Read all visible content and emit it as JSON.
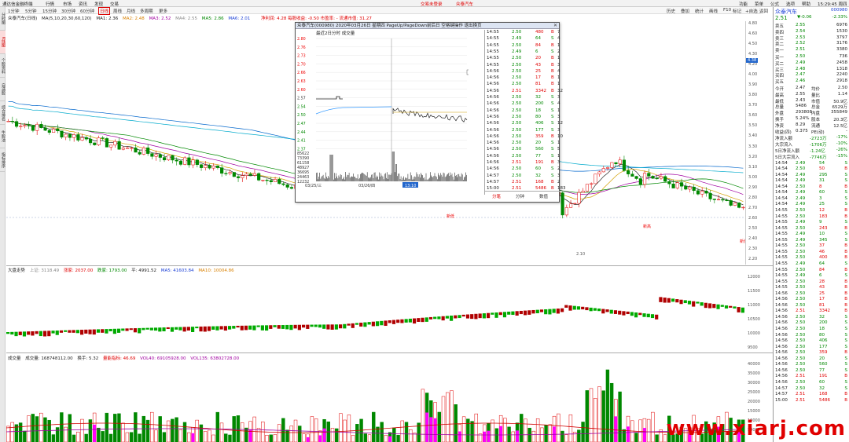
{
  "titlebar": {
    "app": "通达信金融终端",
    "menus": [
      "行情",
      "市场",
      "资讯",
      "发现",
      "交易"
    ],
    "center_text": "交易未登录",
    "stock_name": "众泰汽车",
    "right_items": [
      "功能",
      "菜单",
      "公式",
      "选项",
      "帮助"
    ],
    "time": "15:29:45 周四"
  },
  "sidebar": {
    "tabs": [
      "分时图",
      "K线图",
      "个股资料",
      "自选股",
      "综合排名",
      "牛股池",
      "指标排序"
    ]
  },
  "periodbar": {
    "items": [
      "1分钟",
      "5分钟",
      "15分钟",
      "30分钟",
      "60分钟",
      "日线",
      "周线",
      "月线",
      "多周期",
      "更多"
    ],
    "active_index": 5
  },
  "right_toolbar": [
    "历史",
    "叠加",
    "统计",
    "画线",
    "F10",
    "标记",
    "+自选",
    "返回"
  ],
  "main_legend": {
    "title": "众泰汽车(日线)",
    "ma_spec": "MA(5,10,20,30,60,120)",
    "ma1": "MA1: 2.36",
    "ma2": "MA2: 2.48",
    "ma3": "MA3: 2.52",
    "ma4": "MA4: 2.55",
    "ma5": "MA5: 2.86",
    "ma6": "MA6: 2.01",
    "indicator": "净利润: 4.28  每股收益: -0.50  市盈率: -  流通市值: 31.27"
  },
  "main_axis": [
    "2.10"
  ],
  "main_annotations": [
    "新低",
    "新高",
    "新低"
  ],
  "dapan_legend": {
    "title": "大盘走势",
    "items": [
      "上证: 3118.49",
      "涨家: 2037.00",
      "跌家: 1793.00",
      "平: 4991.52",
      "MA5: 41603.84",
      "MA10: 10004.86"
    ]
  },
  "dapan_axis": [
    "12000",
    "11500",
    "11000",
    "10500",
    "10000",
    "9500"
  ],
  "vol_legend": {
    "title": "成交量",
    "items": [
      "成交量: 168748112.00",
      "换手: 5.32",
      "量能指标: 46.69",
      "VOL40: 69105928.00",
      "VOL135: 63802728.00"
    ]
  },
  "vol_axis": [
    "40000",
    "35000",
    "30000",
    "25000",
    "20000",
    "15000",
    "10000",
    "5000"
  ],
  "popup": {
    "title": "众泰汽车(000980) 2020年03月26日 星期四 PageUp/PageDown前后日 空格键操作 退出换页",
    "sub": "最近2日分时  成交量",
    "price_axis_left": [
      "2.80",
      "2.76",
      "2.73",
      "2.70",
      "2.66",
      "2.63",
      "2.60",
      "2.57",
      "2.54",
      "2.50",
      "2.47",
      "2.44",
      "2.41",
      "2.37"
    ],
    "pct_axis_right": [
      "9.00%",
      "7.67%",
      "6.32%",
      "5.00%",
      "3.64%",
      "2.56%",
      "1.28%",
      "0.00%",
      "1.28%",
      "2.56%",
      "3.84%",
      "5.11%",
      "6.39%",
      "7.67%"
    ],
    "vol_axis": [
      "85622",
      "73390",
      "61158",
      "48927",
      "36695",
      "24463",
      "12232"
    ],
    "dates": [
      "03/25/三",
      "03/26/四"
    ],
    "marker": "13:10",
    "ticks": [
      {
        "t": "14:55",
        "p": "2.50",
        "v": "480",
        "s": "B",
        "n": "7"
      },
      {
        "t": "14:55",
        "p": "2.49",
        "v": "64",
        "s": "S",
        "n": "4"
      },
      {
        "t": "14:55",
        "p": "2.50",
        "v": "84",
        "s": "B",
        "n": "1"
      },
      {
        "t": "14:55",
        "p": "2.49",
        "v": "6",
        "s": "S",
        "n": "2"
      },
      {
        "t": "14:55",
        "p": "2.50",
        "v": "20",
        "s": "B",
        "n": "1"
      },
      {
        "t": "14:55",
        "p": "2.50",
        "v": "43",
        "s": "B",
        "n": "3"
      },
      {
        "t": "14:56",
        "p": "2.50",
        "v": "25",
        "s": "B",
        "n": "4"
      },
      {
        "t": "14:56",
        "p": "2.50",
        "v": "17",
        "s": "B",
        "n": "1"
      },
      {
        "t": "14:56",
        "p": "2.50",
        "v": "81",
        "s": "B",
        "n": "1"
      },
      {
        "t": "14:56",
        "p": "2.51",
        "v": "3342",
        "s": "B",
        "n": "32"
      },
      {
        "t": "14:56",
        "p": "2.50",
        "v": "32",
        "s": "S",
        "n": "3"
      },
      {
        "t": "14:56",
        "p": "2.50",
        "v": "200",
        "s": "S",
        "n": "4"
      },
      {
        "t": "14:56",
        "p": "2.50",
        "v": "18",
        "s": "S",
        "n": "1"
      },
      {
        "t": "14:56",
        "p": "2.50",
        "v": "80",
        "s": "S",
        "n": "3"
      },
      {
        "t": "14:56",
        "p": "2.50",
        "v": "406",
        "s": "S",
        "n": "12"
      },
      {
        "t": "14:56",
        "p": "2.50",
        "v": "177",
        "s": "S",
        "n": "3"
      },
      {
        "t": "14:56",
        "p": "2.50",
        "v": "359",
        "s": "B",
        "n": "10"
      },
      {
        "t": "14:56",
        "p": "2.50",
        "v": "20",
        "s": "S",
        "n": "1"
      },
      {
        "t": "14:56",
        "p": "2.50",
        "v": "560",
        "s": "S",
        "n": "5"
      },
      {
        "t": "14:56",
        "p": "2.50",
        "v": "77",
        "s": "S",
        "n": "1"
      },
      {
        "t": "14:56",
        "p": "2.51",
        "v": "191",
        "s": "B",
        "n": "3"
      },
      {
        "t": "14:56",
        "p": "2.50",
        "v": "60",
        "s": "S",
        "n": "2"
      },
      {
        "t": "14:57",
        "p": "2.50",
        "v": "32",
        "s": "S",
        "n": "3"
      },
      {
        "t": "14:57",
        "p": "2.51",
        "v": "168",
        "s": "B",
        "n": "2"
      },
      {
        "t": "15:00",
        "p": "2.51",
        "v": "5486",
        "s": "B",
        "n": "183"
      }
    ],
    "tabs": [
      "分笔",
      "分钟",
      "数值"
    ]
  },
  "rpanel": {
    "name": "众泰汽车",
    "code": "000980",
    "price": "2.51",
    "change": "▼-0.06",
    "pct": "-2.33%",
    "sells": [
      {
        "label": "卖五",
        "price": "2.55",
        "vol": "6976"
      },
      {
        "label": "卖四",
        "price": "2.54",
        "vol": "1530"
      },
      {
        "label": "卖三",
        "price": "2.53",
        "vol": "3797"
      },
      {
        "label": "卖二",
        "price": "2.52",
        "vol": "3176"
      },
      {
        "label": "卖一",
        "price": "2.51",
        "vol": "3380"
      }
    ],
    "buys": [
      {
        "label": "买一",
        "price": "2.50",
        "vol": "736"
      },
      {
        "label": "买二",
        "price": "2.49",
        "vol": "2458"
      },
      {
        "label": "买三",
        "price": "2.48",
        "vol": "1318"
      },
      {
        "label": "买四",
        "price": "2.47",
        "vol": "2240"
      },
      {
        "label": "买五",
        "price": "2.46",
        "vol": "2918"
      }
    ],
    "stats": [
      {
        "a": "今开",
        "b": "2.47",
        "c": "均价",
        "d": "2.50"
      },
      {
        "a": "最高",
        "b": "2.55",
        "c": "量比",
        "d": "1.14"
      },
      {
        "a": "最低",
        "b": "2.43",
        "c": "市值",
        "d": "50.9亿"
      },
      {
        "a": "总量",
        "b": "5486",
        "c": "总金",
        "d": "6529万"
      },
      {
        "a": "外盘",
        "b": "293808",
        "c": "内盘",
        "d": "355849"
      },
      {
        "a": "换手",
        "b": "5.24%",
        "c": "股本",
        "d": "20.3亿"
      },
      {
        "a": "净资",
        "b": "8.29",
        "c": "流通",
        "d": "12.5亿"
      },
      {
        "a": "收益(四)",
        "b": "0.375",
        "c": "PE(动)",
        "d": "-"
      }
    ],
    "flows": [
      {
        "a": "净流入额",
        "b": "-2723万",
        "c": "-17%"
      },
      {
        "a": "大宗流入",
        "b": "-1706万",
        "c": "-10%"
      },
      {
        "a": "5日净流入额",
        "b": "-1.24亿",
        "c": "-26%"
      },
      {
        "a": "5日大宗流入",
        "b": "-7746万",
        "c": "-15%"
      }
    ],
    "ticks": [
      {
        "t": "14:54",
        "p": "2.49",
        "v": "54",
        "s": "S"
      },
      {
        "t": "14:54",
        "p": "2.50",
        "v": "50",
        "s": "B"
      },
      {
        "t": "14:54",
        "p": "2.49",
        "v": "295",
        "s": "S"
      },
      {
        "t": "14:54",
        "p": "2.49",
        "v": "31",
        "s": "S"
      },
      {
        "t": "14:54",
        "p": "2.50",
        "v": "8",
        "s": "B"
      },
      {
        "t": "14:54",
        "p": "2.49",
        "v": "60",
        "s": "S"
      },
      {
        "t": "14:54",
        "p": "2.49",
        "v": "3",
        "s": "S"
      },
      {
        "t": "14:54",
        "p": "2.49",
        "v": "25",
        "s": "S"
      },
      {
        "t": "14:55",
        "p": "2.50",
        "v": "12",
        "s": "B"
      },
      {
        "t": "14:55",
        "p": "2.50",
        "v": "183",
        "s": "B"
      },
      {
        "t": "14:55",
        "p": "2.49",
        "v": "9",
        "s": "S"
      },
      {
        "t": "14:55",
        "p": "2.50",
        "v": "243",
        "s": "B"
      },
      {
        "t": "14:55",
        "p": "2.49",
        "v": "10",
        "s": "S"
      },
      {
        "t": "14:55",
        "p": "2.49",
        "v": "345",
        "s": "S"
      },
      {
        "t": "14:55",
        "p": "2.50",
        "v": "37",
        "s": "B"
      },
      {
        "t": "14:55",
        "p": "2.50",
        "v": "46",
        "s": "B"
      },
      {
        "t": "14:55",
        "p": "2.50",
        "v": "400",
        "s": "B"
      },
      {
        "t": "14:55",
        "p": "2.49",
        "v": "64",
        "s": "S"
      },
      {
        "t": "14:55",
        "p": "2.50",
        "v": "84",
        "s": "B"
      },
      {
        "t": "14:55",
        "p": "2.49",
        "v": "6",
        "s": "S"
      },
      {
        "t": "14:55",
        "p": "2.50",
        "v": "28",
        "s": "B"
      },
      {
        "t": "14:55",
        "p": "2.50",
        "v": "43",
        "s": "B"
      },
      {
        "t": "14:56",
        "p": "2.50",
        "v": "25",
        "s": "B"
      },
      {
        "t": "14:56",
        "p": "2.50",
        "v": "17",
        "s": "B"
      },
      {
        "t": "14:56",
        "p": "2.50",
        "v": "81",
        "s": "B"
      },
      {
        "t": "14:56",
        "p": "2.51",
        "v": "3342",
        "s": "B"
      },
      {
        "t": "14:56",
        "p": "2.50",
        "v": "32",
        "s": "S"
      },
      {
        "t": "14:56",
        "p": "2.50",
        "v": "200",
        "s": "S"
      },
      {
        "t": "14:56",
        "p": "2.50",
        "v": "18",
        "s": "S"
      },
      {
        "t": "14:56",
        "p": "2.50",
        "v": "80",
        "s": "S"
      },
      {
        "t": "14:56",
        "p": "2.50",
        "v": "406",
        "s": "S"
      },
      {
        "t": "14:56",
        "p": "2.50",
        "v": "177",
        "s": "S"
      },
      {
        "t": "14:56",
        "p": "2.50",
        "v": "359",
        "s": "B"
      },
      {
        "t": "14:56",
        "p": "2.50",
        "v": "20",
        "s": "S"
      },
      {
        "t": "14:56",
        "p": "2.50",
        "v": "560",
        "s": "S"
      },
      {
        "t": "14:56",
        "p": "2.50",
        "v": "77",
        "s": "S"
      },
      {
        "t": "14:56",
        "p": "2.51",
        "v": "191",
        "s": "B"
      },
      {
        "t": "14:56",
        "p": "2.50",
        "v": "60",
        "s": "S"
      },
      {
        "t": "14:57",
        "p": "2.50",
        "v": "32",
        "s": "S"
      },
      {
        "t": "14:57",
        "p": "2.51",
        "v": "168",
        "s": "B"
      },
      {
        "t": "15:00",
        "p": "2.51",
        "v": "5486",
        "s": "B"
      }
    ]
  },
  "price_axis": [
    "4.80",
    "4.60",
    "4.50",
    "4.30",
    "4.20",
    "4.00",
    "3.90",
    "3.80",
    "3.70",
    "3.60",
    "3.50",
    "3.40",
    "3.30",
    "3.20",
    "3.10",
    "3.00",
    "2.90",
    "2.80",
    "2.70",
    "2.60",
    "2.50",
    "2.40",
    "2.30",
    "2.20"
  ],
  "price_axis_highlight": "4.38",
  "watermark": "www.xiarj.com",
  "colors": {
    "up": "#e00000",
    "down": "#008800",
    "ma1": "#222222",
    "ma2": "#d4a000",
    "ma3": "#a000a0",
    "ma4": "#008800",
    "ma5": "#0066cc",
    "ma6": "#00aacc"
  }
}
